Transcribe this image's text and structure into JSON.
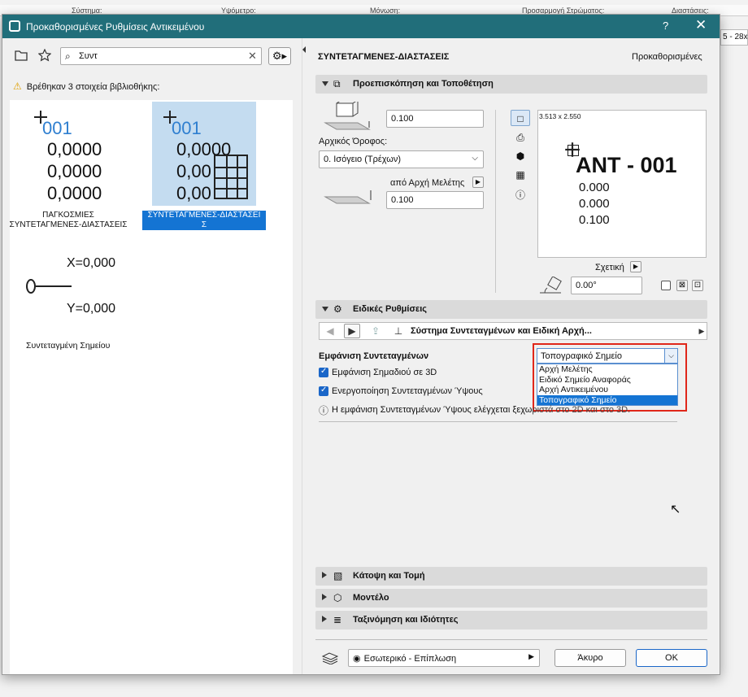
{
  "background": {
    "columns": [
      "Σύστημα:",
      "Υψόμετρο:",
      "Μόνωση:",
      "Προσαρμογή Στρώματος:",
      "Διαστάσεις:"
    ],
    "right_field": "5 - 28x"
  },
  "dialog": {
    "title": "Προκαθορισμένες Ρυθμίσεις Αντικειμένου",
    "help": "?",
    "close": "✕"
  },
  "left": {
    "search_value": "Συντ",
    "found_text": "Βρέθηκαν 3 στοιχεία βιβλιοθήκης:",
    "items": [
      {
        "number": "001",
        "values": [
          "0,0000",
          "0,0000",
          "0,0000"
        ],
        "caption_line1": "ΠΑΓΚΟΣΜΙΕΣ",
        "caption_line2": "ΣΥΝΤΕΤΑΓΜΕΝΕΣ-ΔΙΑΣΤΑΣΕΙΣ"
      },
      {
        "number": "001",
        "values": [
          "0,0000",
          "0,00",
          "0,00"
        ],
        "caption_line1": "ΣΥΝΤΕΤΑΓΜΕΝΕΣ-ΔΙΑΣΤΑΣΕΙ",
        "caption_line2": "Σ"
      },
      {
        "x_text": "X=0,000",
        "y_text": "Y=0,000",
        "caption": "Συντεταγμένη Σημείου"
      }
    ]
  },
  "right": {
    "object_name": "ΣΥΝΤΕΤΑΓΜΕΝΕΣ-ΔΙΑΣΤΑΣΕΙΣ",
    "preset_label": "Προκαθορισμένες",
    "section_preview": "Προεπισκόπηση και Τοποθέτηση",
    "height_value_1": "0.100",
    "home_floor_label": "Αρχικός Όροφος:",
    "home_floor_value": "0. Ισόγειο (Τρέχων)",
    "from_label": "από Αρχή Μελέτης",
    "height_value_2": "0.100",
    "preview": {
      "size_text": "3.513 x 2.550",
      "title": "ANT - 001",
      "v1": "0.000",
      "v2": "0.000",
      "v3": "0.100"
    },
    "relative_label": "Σχετική",
    "angle_value": "0.00°",
    "section_special": "Ειδικές Ρυθμίσεις",
    "nav_page": "Σύστημα Συντεταγμένων και Ειδική Αρχή...",
    "display_label": "Εμφάνιση Συντεταγμένων",
    "dropdown_value": "Τοπογραφικό Σημείο",
    "dropdown_options": [
      "Αρχή Μελέτης",
      "Ειδικό Σημείο Αναφοράς",
      "Αρχή Αντικειμένου",
      "Τοπογραφικό Σημείο"
    ],
    "check1": "Εμφάνιση Σημαδιού σε 3D",
    "check2": "Ενεργοποίηση Συντεταγμένων Ύψους",
    "info_text": "Η εμφάνιση Συντεταγμένων Ύψους ελέγχεται ξεχωριστά στο 2D και στο 3D.",
    "section_plan": "Κάτοψη και Τομή",
    "section_model": "Μοντέλο",
    "section_class": "Ταξινόμηση και Ιδιότητες",
    "layer_value": "Εσωτερικό - Επίπλωση",
    "cancel": "Άκυρο",
    "ok": "OK"
  }
}
